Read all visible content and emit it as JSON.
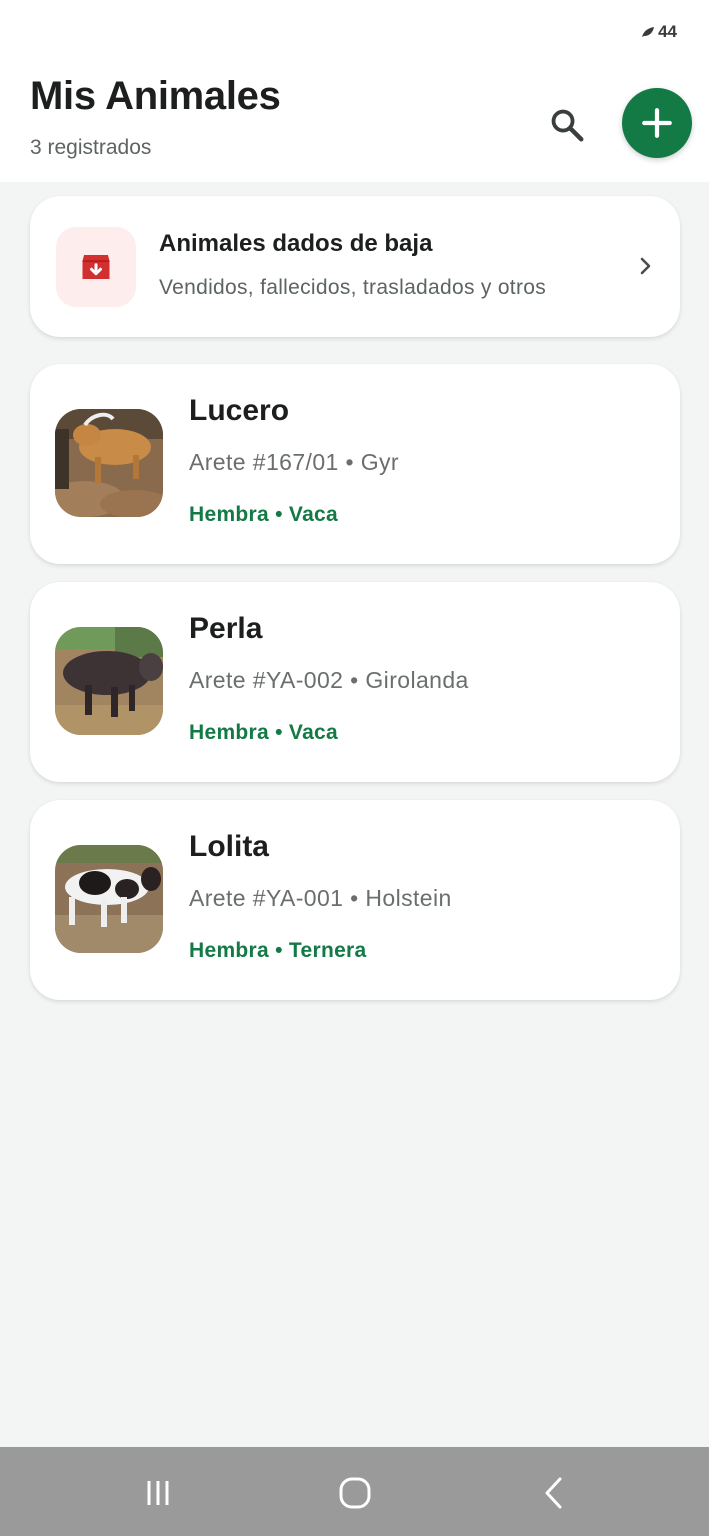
{
  "status_bar": {
    "indicator": "44"
  },
  "header": {
    "title": "Mis Animales",
    "subtitle": "3 registrados",
    "search_icon": "search-icon",
    "add_icon": "plus-icon",
    "accent_color": "#137a45"
  },
  "archive": {
    "title": "Animales dados de baja",
    "subtitle": "Vendidos, fallecidos, trasladados y otros",
    "icon": "archive-icon",
    "icon_color": "#d32f2f"
  },
  "animals": [
    {
      "name": "Lucero",
      "meta": "Arete #167/01 • Gyr",
      "tags": "Hembra • Vaca"
    },
    {
      "name": "Perla",
      "meta": "Arete #YA-002 • Girolanda",
      "tags": "Hembra • Vaca"
    },
    {
      "name": "Lolita",
      "meta": "Arete #YA-001 • Holstein",
      "tags": "Hembra • Ternera"
    }
  ],
  "nav": {
    "recents": "recents-icon",
    "home": "home-icon",
    "back": "back-icon"
  }
}
